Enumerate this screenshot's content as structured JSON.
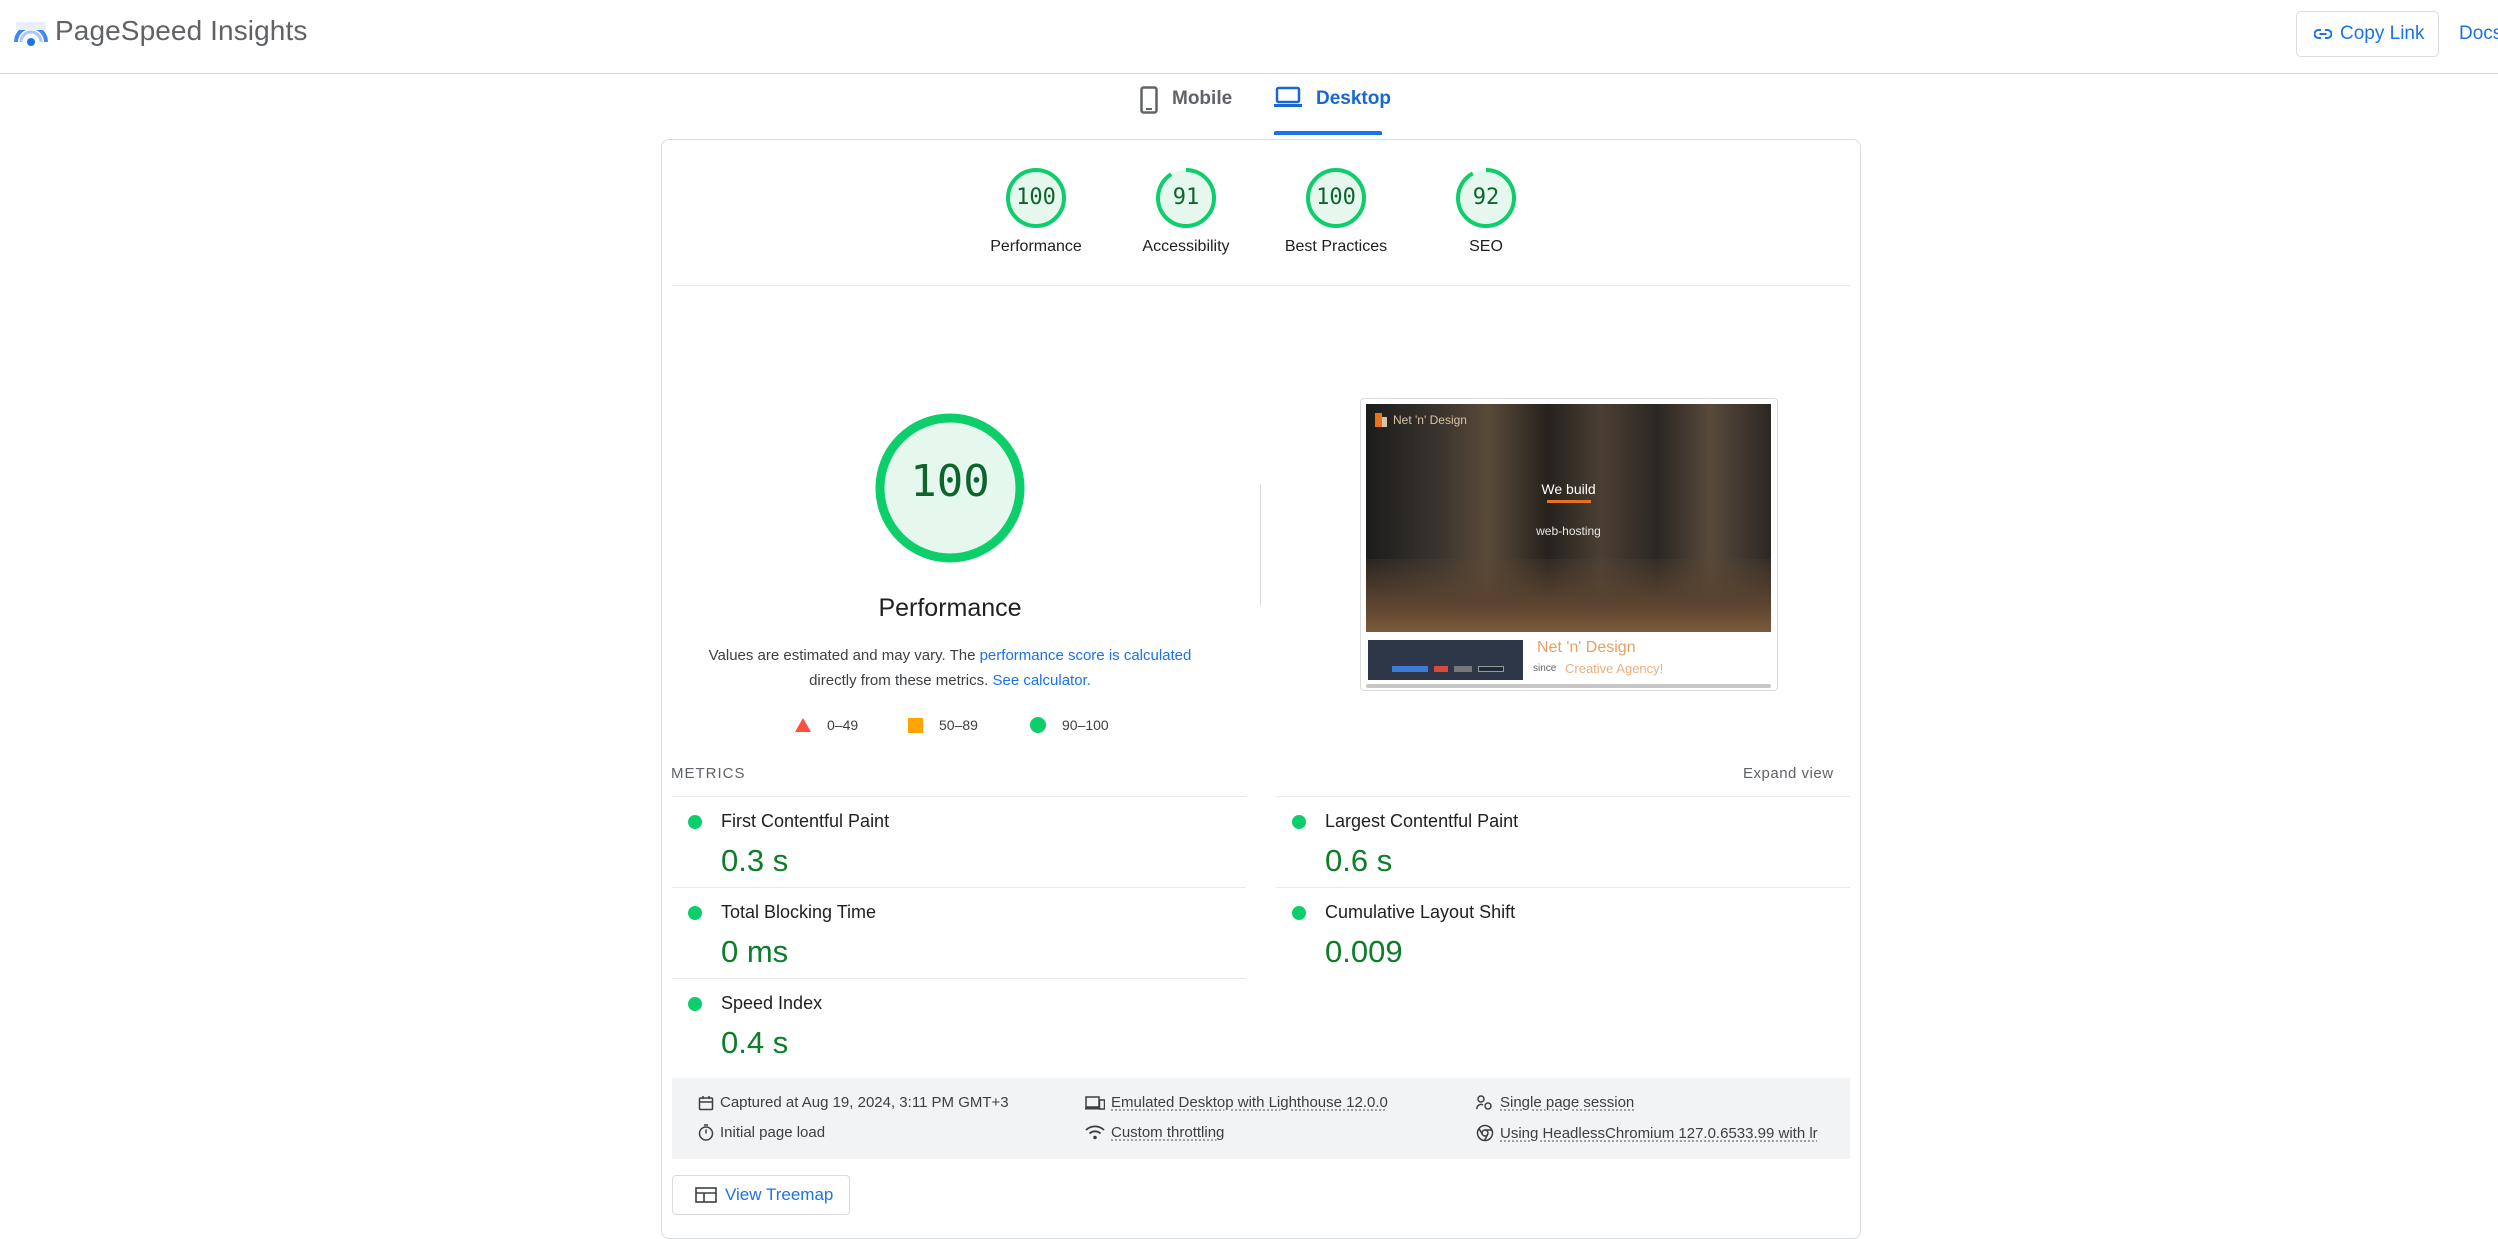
{
  "app": {
    "title": "PageSpeed Insights",
    "copy_link": "Copy Link",
    "docs": "Docs"
  },
  "tabs": [
    {
      "label": "Mobile",
      "icon": "phone-icon",
      "active": false
    },
    {
      "label": "Desktop",
      "icon": "laptop-icon",
      "active": true
    }
  ],
  "scores": [
    {
      "value": "100",
      "label": "Performance",
      "fraction": 1.0
    },
    {
      "value": "91",
      "label": "Accessibility",
      "fraction": 0.91
    },
    {
      "value": "100",
      "label": "Best Practices",
      "fraction": 1.0
    },
    {
      "value": "92",
      "label": "SEO",
      "fraction": 0.92
    }
  ],
  "performance": {
    "score": "100",
    "title": "Performance",
    "note_pre": "Values are estimated and may vary. The ",
    "note_link": "performance score is calculated",
    "note_mid": "directly from these metrics. ",
    "note_link2": "See calculator.",
    "legend": [
      {
        "range": "0–49",
        "shape": "triangle",
        "color": "#ff4e42"
      },
      {
        "range": "50–89",
        "shape": "square",
        "color": "#ffa400"
      },
      {
        "range": "90–100",
        "shape": "circle",
        "color": "#0cce6b"
      }
    ]
  },
  "screenshot": {
    "hero_line1": "We build",
    "hero_line2": "web-hosting",
    "brand_top": "Net 'n' Design",
    "brand": "Net 'n' Design",
    "tag_small": "since",
    "tag": "Creative Agency!"
  },
  "metrics": {
    "title": "METRICS",
    "expand": "Expand view",
    "items": [
      {
        "name": "First Contentful Paint",
        "value": "0.3 s"
      },
      {
        "name": "Largest Contentful Paint",
        "value": "0.6 s"
      },
      {
        "name": "Total Blocking Time",
        "value": "0 ms"
      },
      {
        "name": "Cumulative Layout Shift",
        "value": "0.009"
      },
      {
        "name": "Speed Index",
        "value": "0.4 s"
      }
    ]
  },
  "info": {
    "captured": "Captured at Aug 19, 2024, 3:11 PM GMT+3",
    "initial": "Initial page load",
    "emulated": "Emulated Desktop with Lighthouse 12.0.0",
    "throttling": "Custom throttling",
    "session": "Single page session",
    "browser": "Using HeadlessChromium 127.0.6533.99 with lr"
  },
  "treemap": {
    "label": "View Treemap"
  },
  "colors": {
    "pass": "#0cce6b",
    "pass_text": "#0d7d2a",
    "accent": "#1a73e8"
  }
}
